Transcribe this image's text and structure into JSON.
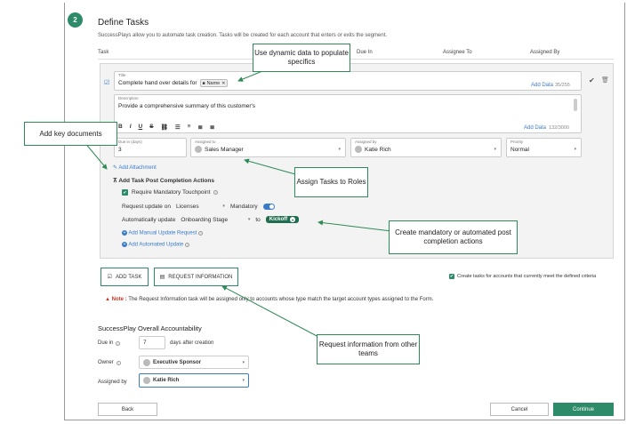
{
  "step": {
    "number": "2",
    "title": "Define Tasks",
    "subtitle": "SuccessPlays allow you to automate task creation. Tasks will be created for each account that enters or exits the segment."
  },
  "columns": {
    "task": "Task",
    "due_in": "Due In",
    "assignee_to": "Assignee To",
    "assigned_by": "Assigned By"
  },
  "task": {
    "title_label": "Title",
    "title_value": "Complete hand over details for",
    "title_tag": "Name",
    "title_count": "35/255",
    "add_data": "Add Data",
    "desc_label": "Description",
    "desc_value": "Provide a comprehensive summary of this customer's",
    "desc_count": "132/3000",
    "due_label": "Due in (days)",
    "due_value": "3",
    "assigned_to_label": "Assigned to",
    "assigned_to_value": "Sales Manager",
    "assigned_by_label": "Assigned by",
    "assigned_by_value": "Katie Rich",
    "priority_label": "Priority",
    "priority_value": "Normal",
    "add_attachment": "Add Attachment",
    "post_actions": "Add Task Post Completion Actions",
    "require_touchpoint": "Require Mandatory Touchpoint",
    "request_update_on": "Request update on",
    "licenses": "Licenses",
    "mandatory": "Mandatory",
    "auto_update": "Automatically update",
    "onboarding_stage": "Onboarding Stage",
    "to": "to",
    "kickoff": "Kickoff",
    "add_manual": "Add Manual Update Request",
    "add_automated": "Add Automated Update"
  },
  "toolbar": {
    "b": "B",
    "i": "I",
    "u": "U",
    "s": "S",
    "link": "⛓",
    "ul": "☰",
    "ol": "≡",
    "al": "≣",
    "ar": "≣"
  },
  "buttons": {
    "add_task": "ADD TASK",
    "request_info": "REQUEST INFORMATION",
    "back": "Back",
    "cancel": "Cancel",
    "continue": "Continue"
  },
  "create_tasks_text": "Create tasks for accounts that currently meet the defined criteria",
  "note": {
    "label": "Note :",
    "text": "The Request Information task will be assigned only to accounts whose type match the target account types assigned to the Form."
  },
  "accountability": {
    "heading": "SuccessPlay Overall Accountability",
    "due_in_label": "Due in",
    "due_in_value": "7",
    "days_after": "days after creation",
    "owner_label": "Owner",
    "owner_value": "Executive Sponsor",
    "assigned_by_label": "Assigned by",
    "assigned_by_value": "Katie Rich"
  },
  "callouts": {
    "dynamic": "Use dynamic data to populate specifics",
    "documents": "Add key documents",
    "roles": "Assign Tasks to Roles",
    "actions": "Create mandatory or automated post completion actions",
    "request": "Request information from other teams"
  },
  "colors": {
    "accent": "#2e8b6a",
    "link": "#3a7bc8",
    "callout_border": "#2e8b57"
  }
}
